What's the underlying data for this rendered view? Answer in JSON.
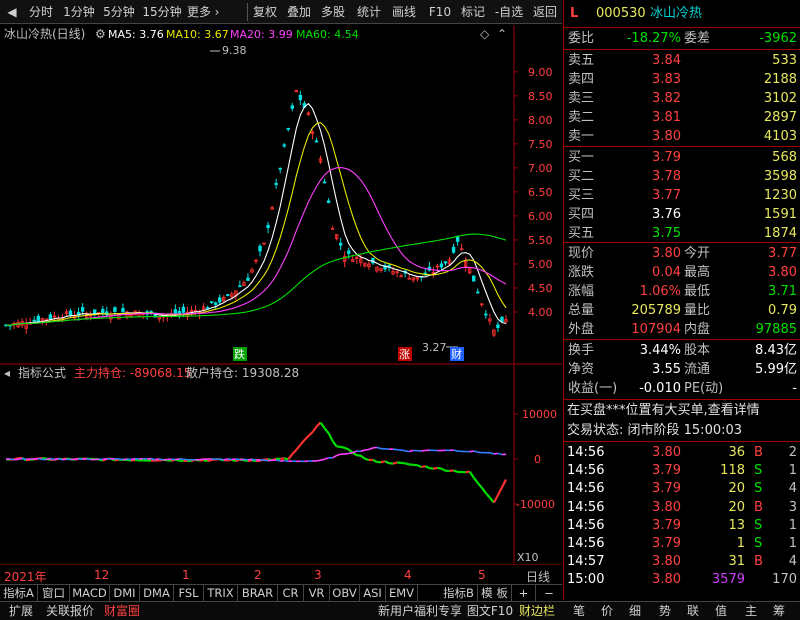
{
  "toolbar": {
    "buttons": [
      "分时",
      "1分钟",
      "5分钟",
      "15分钟",
      "更多",
      "复权",
      "叠加",
      "多股",
      "统计",
      "画线",
      "F10",
      "标记",
      "-自选",
      "返回"
    ],
    "more_arrow": "›"
  },
  "main_chart": {
    "title": "冰山冷热(日线)",
    "ma_labels": [
      "MA5: 3.76",
      "MA10: 3.67",
      "MA20: 3.99",
      "MA60: 4.54"
    ],
    "ma_colors": [
      "#ffffff",
      "#e8e800",
      "#ff40ff",
      "#00e000"
    ],
    "high_marker": "9.38",
    "low_marker": "3.27",
    "y_ticks": [
      "9.00",
      "8.50",
      "8.00",
      "7.50",
      "7.00",
      "6.50",
      "6.00",
      "5.50",
      "5.00",
      "4.50",
      "4.00"
    ],
    "y_values": [
      9.0,
      8.5,
      8.0,
      7.5,
      7.0,
      6.5,
      6.0,
      5.5,
      5.0,
      4.5,
      4.0
    ],
    "ylim": [
      3.0,
      9.6
    ],
    "event_badges": [
      {
        "text": "跌",
        "color": "#00a000"
      },
      {
        "text": "涨",
        "color": "#c00000"
      },
      {
        "text": "财",
        "color": "#2060ff"
      }
    ]
  },
  "indicator": {
    "title": "指标公式",
    "main_label": "主力持仓: -89068.15",
    "retail_label": "散户持仓: 19308.28",
    "y_ticks": [
      "10000",
      "0",
      "-10000"
    ],
    "y_values": [
      10000,
      0,
      -10000
    ],
    "scale_label": "X10"
  },
  "x_axis": {
    "labels": [
      "2021年",
      "12",
      "1",
      "2",
      "3",
      "4",
      "5"
    ],
    "period_label": "日线"
  },
  "tabs_row1": [
    "指标A",
    "窗口",
    "MACD",
    "DMI",
    "DMA",
    "FSL",
    "TRIX",
    "BRAR",
    "CR",
    "VR",
    "OBV",
    "ASI",
    "EMV",
    "指标B",
    "模 板",
    "+",
    "−"
  ],
  "tabs_row2": [
    "扩展",
    "关联报价",
    "财富圈",
    "新用户福利专享",
    "图文F10",
    "财边栏"
  ],
  "bottom_right_tabs": [
    "笔",
    "价",
    "细",
    "势",
    "联",
    "值",
    "主",
    "筹"
  ],
  "quote": {
    "marker": "L",
    "code": "000530",
    "name": "冰山冷热",
    "weibi_label": "委比",
    "weibi_value": "-18.27%",
    "weicha_label": "委差",
    "weicha_value": "-3962",
    "asks": [
      {
        "label": "卖五",
        "price": "3.84",
        "vol": "533"
      },
      {
        "label": "卖四",
        "price": "3.83",
        "vol": "2188"
      },
      {
        "label": "卖三",
        "price": "3.82",
        "vol": "3102"
      },
      {
        "label": "卖二",
        "price": "3.81",
        "vol": "2897"
      },
      {
        "label": "卖一",
        "price": "3.80",
        "vol": "4103"
      }
    ],
    "bids": [
      {
        "label": "买一",
        "price": "3.79",
        "vol": "568"
      },
      {
        "label": "买二",
        "price": "3.78",
        "vol": "3598"
      },
      {
        "label": "买三",
        "price": "3.77",
        "vol": "1230"
      },
      {
        "label": "买四",
        "price": "3.76",
        "vol": "1591"
      },
      {
        "label": "买五",
        "price": "3.75",
        "vol": "1874"
      }
    ],
    "stats": [
      {
        "l1": "现价",
        "v1": "3.80",
        "c1": "red",
        "l2": "今开",
        "v2": "3.77",
        "c2": "red"
      },
      {
        "l1": "涨跌",
        "v1": "0.04",
        "c1": "red",
        "l2": "最高",
        "v2": "3.80",
        "c2": "red"
      },
      {
        "l1": "涨幅",
        "v1": "1.06%",
        "c1": "red",
        "l2": "最低",
        "v2": "3.71",
        "c2": "green"
      },
      {
        "l1": "总量",
        "v1": "205789",
        "c1": "yellow",
        "l2": "量比",
        "v2": "0.79",
        "c2": "yellow"
      },
      {
        "l1": "外盘",
        "v1": "107904",
        "c1": "red",
        "l2": "内盘",
        "v2": "97885",
        "c2": "green"
      }
    ],
    "stats2": [
      {
        "l1": "换手",
        "v1": "3.44%",
        "l2": "股本",
        "v2": "8.43亿"
      },
      {
        "l1": "净资",
        "v1": "3.55",
        "l2": "流通",
        "v2": "5.99亿"
      },
      {
        "l1": "收益(一)",
        "v1": "-0.010",
        "l2": "PE(动)",
        "v2": "-"
      }
    ],
    "notice": "在买盘***位置有大买单,查看详情",
    "status": "交易状态: 闭市阶段 15:00:03",
    "ticks": [
      {
        "t": "14:56",
        "p": "3.80",
        "pc": "red",
        "v": "36",
        "vc": "yellow",
        "s": "B",
        "sc": "red",
        "n": "2"
      },
      {
        "t": "14:56",
        "p": "3.79",
        "pc": "red",
        "v": "118",
        "vc": "yellow",
        "s": "S",
        "sc": "green",
        "n": "1"
      },
      {
        "t": "14:56",
        "p": "3.79",
        "pc": "red",
        "v": "20",
        "vc": "yellow",
        "s": "S",
        "sc": "green",
        "n": "4"
      },
      {
        "t": "14:56",
        "p": "3.80",
        "pc": "red",
        "v": "20",
        "vc": "yellow",
        "s": "B",
        "sc": "red",
        "n": "3"
      },
      {
        "t": "14:56",
        "p": "3.79",
        "pc": "red",
        "v": "13",
        "vc": "yellow",
        "s": "S",
        "sc": "green",
        "n": "1"
      },
      {
        "t": "14:56",
        "p": "3.79",
        "pc": "red",
        "v": "1",
        "vc": "yellow",
        "s": "S",
        "sc": "green",
        "n": "1"
      },
      {
        "t": "14:57",
        "p": "3.80",
        "pc": "red",
        "v": "31",
        "vc": "yellow",
        "s": "B",
        "sc": "red",
        "n": "4"
      },
      {
        "t": "15:00",
        "p": "3.80",
        "pc": "red",
        "v": "3579",
        "vc": "purple",
        "s": "",
        "sc": "gray",
        "n": "170"
      }
    ]
  }
}
